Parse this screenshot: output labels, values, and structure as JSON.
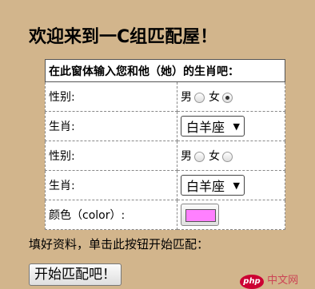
{
  "page": {
    "title": "欢迎来到一C组匹配屋！",
    "form_header": "在此窗体输入您和他（她）的生肖吧：",
    "rows": {
      "gender1": {
        "label": "性别:",
        "male": "男",
        "female": "女",
        "selected": "女"
      },
      "zodiac1": {
        "label": "生肖:",
        "value": "白羊座"
      },
      "gender2": {
        "label": "性别:",
        "male": "男",
        "female": "女",
        "selected": ""
      },
      "zodiac2": {
        "label": "生肖:",
        "value": "白羊座"
      },
      "color": {
        "label": "颜色（color）:",
        "value": "#ff80ff"
      }
    },
    "hint": "填好资料，单击此按钮开始匹配：",
    "submit_label": "开始匹配吧！",
    "watermark_text": "中文网",
    "watermark_logo": "php"
  }
}
